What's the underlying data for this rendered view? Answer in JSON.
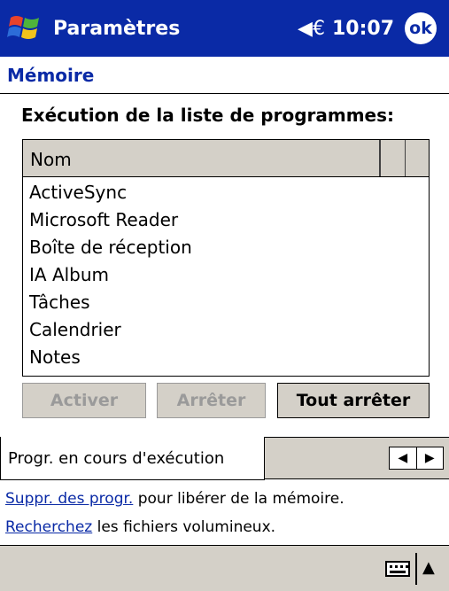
{
  "titlebar": {
    "title": "Paramètres",
    "volume_icon": "speaker-icon",
    "time": "10:07",
    "ok_label": "ok"
  },
  "page": {
    "tab_title": "Mémoire",
    "section_label": "Exécution de la liste de programmes:"
  },
  "program_list": {
    "column_header": "Nom",
    "items": [
      "ActiveSync",
      "Microsoft Reader",
      "Boîte de réception",
      "IA Album",
      "Tâches",
      "Calendrier",
      "Notes"
    ]
  },
  "buttons": {
    "activate": "Activer",
    "stop": "Arrêter",
    "stop_all": "Tout arrêter"
  },
  "tabs": {
    "active": "Progr. en cours d'exécution"
  },
  "info": {
    "line1_link": "Suppr. des progr.",
    "line1_text": " pour libérer de la mémoire.",
    "line2_link": "Recherchez",
    "line2_text": " les fichiers volumineux."
  },
  "colors": {
    "titlebar": "#0a2aa6",
    "chrome": "#d4d0c8",
    "link": "#0a2aa6"
  }
}
